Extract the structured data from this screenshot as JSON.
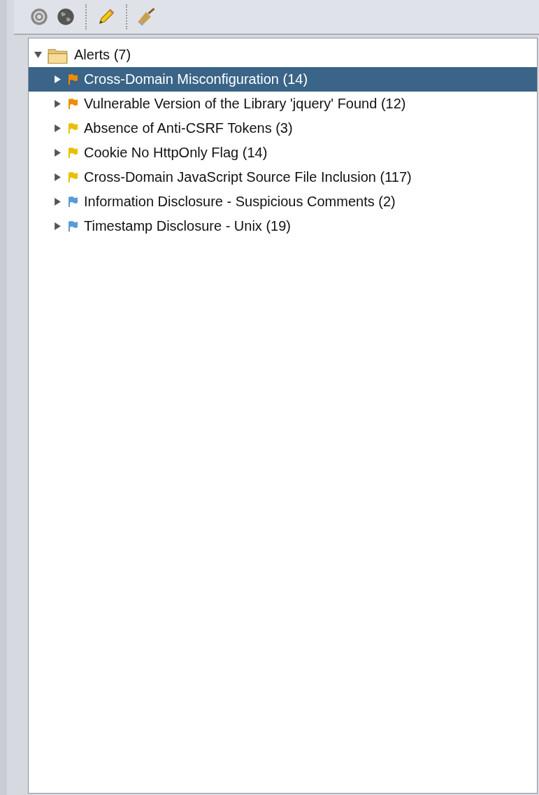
{
  "tree": {
    "label": "Alerts (7)",
    "expanded": true,
    "children": [
      {
        "label": "Cross-Domain Misconfiguration (14)",
        "color": "#f08c00",
        "selected": true,
        "expanded": false
      },
      {
        "label": "Vulnerable Version of the Library 'jquery' Found (12)",
        "color": "#f08c00",
        "selected": false,
        "expanded": false
      },
      {
        "label": "Absence of Anti-CSRF Tokens (3)",
        "color": "#e8c000",
        "selected": false,
        "expanded": false
      },
      {
        "label": "Cookie No HttpOnly Flag (14)",
        "color": "#e8c000",
        "selected": false,
        "expanded": false
      },
      {
        "label": "Cross-Domain JavaScript Source File Inclusion (117)",
        "color": "#e8c000",
        "selected": false,
        "expanded": false
      },
      {
        "label": "Information Disclosure - Suspicious Comments (2)",
        "color": "#5b9bd5",
        "selected": false,
        "expanded": false
      },
      {
        "label": "Timestamp Disclosure - Unix (19)",
        "color": "#5b9bd5",
        "selected": false,
        "expanded": false
      }
    ]
  }
}
